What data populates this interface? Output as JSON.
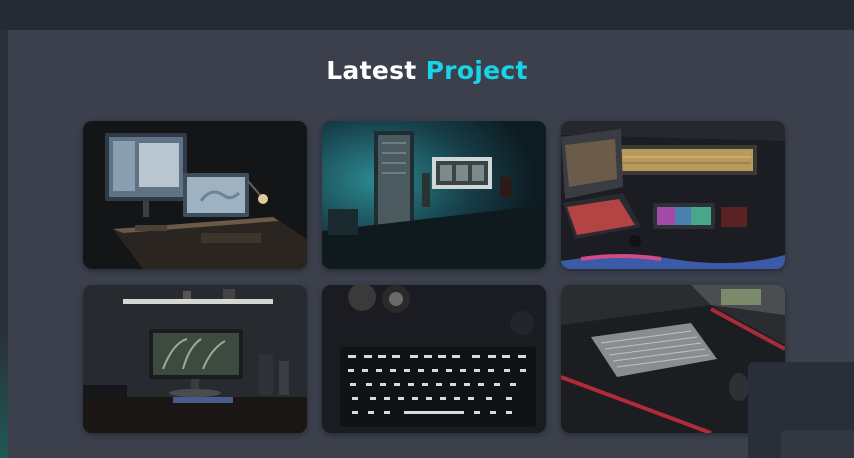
{
  "section": {
    "title_part1": "Latest",
    "title_part2": "Project"
  },
  "projects": [
    {
      "name": "desk-setup-imac"
    },
    {
      "name": "desk-setup-teal-monitor"
    },
    {
      "name": "desk-setup-rgb-laptop"
    },
    {
      "name": "desk-setup-shelf-monitor"
    },
    {
      "name": "keyboard-topdown"
    },
    {
      "name": "keyboard-desk-mat"
    }
  ],
  "colors": {
    "accent": "#19d3e6",
    "background": "#3b404c",
    "topbar": "#262a33"
  }
}
